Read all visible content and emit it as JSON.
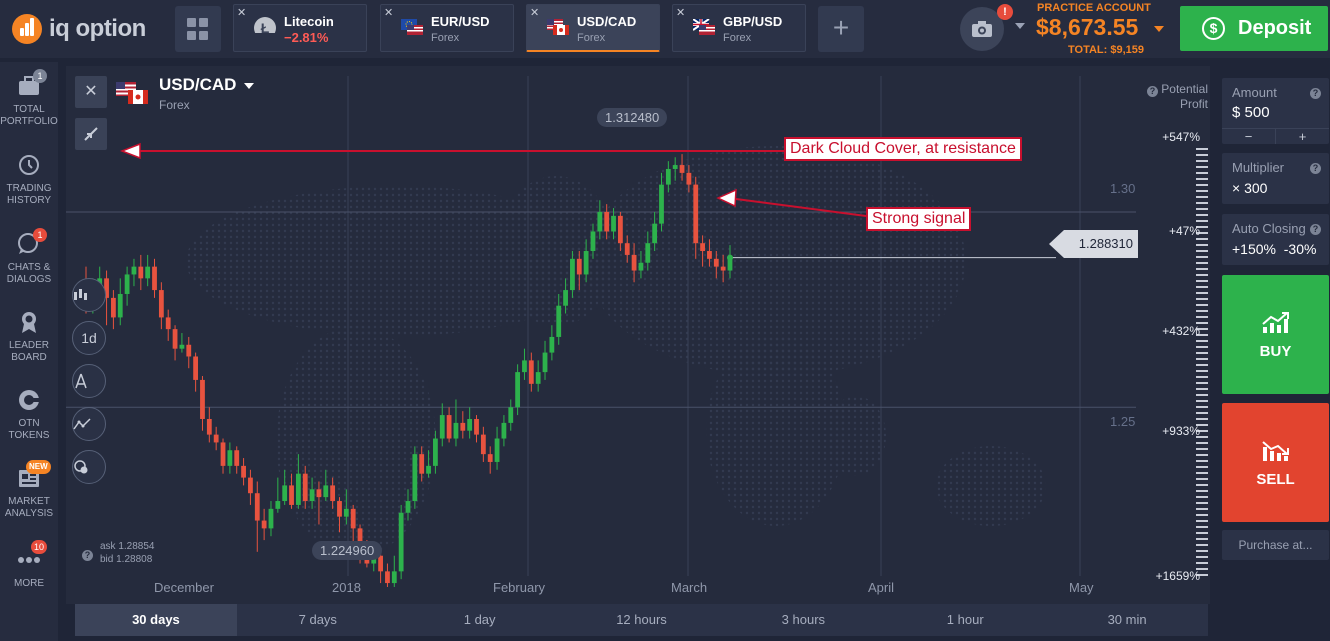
{
  "brand": {
    "name": "iq option"
  },
  "asset_tabs": [
    {
      "name": "Litecoin",
      "sub": "−2.81%",
      "sub_negative": true,
      "icon": "litecoin-icon"
    },
    {
      "name": "EUR/USD",
      "sub": "Forex",
      "icon": "flag-eu-us"
    },
    {
      "name": "USD/CAD",
      "sub": "Forex",
      "icon": "flag-us-ca",
      "active": true
    },
    {
      "name": "GBP/USD",
      "sub": "Forex",
      "icon": "flag-gb-us"
    }
  ],
  "account": {
    "label": "PRACTICE ACCOUNT",
    "balance": "$8,673.55",
    "total": "TOTAL: $9,159",
    "alert": "!"
  },
  "deposit": {
    "label": "Deposit"
  },
  "sidebar": {
    "items": [
      {
        "label_1": "TOTAL",
        "label_2": "PORTFOLIO",
        "badge": "1",
        "icon": "briefcase-icon"
      },
      {
        "label_1": "TRADING",
        "label_2": "HISTORY",
        "icon": "history-icon"
      },
      {
        "label_1": "CHATS &",
        "label_2": "DIALOGS",
        "badge": "1",
        "icon": "chat-icon"
      },
      {
        "label_1": "LEADER",
        "label_2": "BOARD",
        "icon": "award-icon"
      },
      {
        "label_1": "OTN",
        "label_2": "TOKENS",
        "icon": "otn-icon"
      },
      {
        "label_1": "MARKET",
        "label_2": "ANALYSIS",
        "badge": "NEW",
        "icon": "news-icon"
      },
      {
        "label_1": "MORE",
        "label_2": "",
        "badge": "10",
        "icon": "more-icon"
      }
    ]
  },
  "chart": {
    "pair": "USD/CAD",
    "category": "Forex",
    "potential_label_1": "Potential",
    "potential_label_2": "Profit",
    "current_price": "1.288310",
    "high_price": "1.312480",
    "low_price": "1.224960",
    "ask": "ask 1.28854",
    "bid": "bid 1.28808",
    "callout_resistance": "Dark Cloud Cover, at resistance",
    "callout_signal": "Strong signal",
    "timeframe_button": "1d",
    "y_ticks": [
      "1.30",
      "1.25"
    ],
    "x_ticks": [
      "December",
      "2018",
      "February",
      "March",
      "April",
      "May"
    ],
    "profit_ticks": [
      "+547%",
      "+47%",
      "+432%",
      "+933%",
      "+1659%"
    ],
    "accent_up": "#2db24c",
    "accent_down": "#e8533f"
  },
  "chart_data": {
    "type": "candlestick",
    "title": "USD/CAD",
    "ylabel": "",
    "ylim": [
      1.215,
      1.322
    ],
    "x_ticks": [
      "December",
      "2018",
      "February",
      "March",
      "April",
      "May"
    ],
    "candles": [
      [
        1.281,
        1.277,
        1.286,
        1.274
      ],
      [
        1.277,
        1.279,
        1.283,
        1.274
      ],
      [
        1.279,
        1.283,
        1.286,
        1.276
      ],
      [
        1.283,
        1.278,
        1.285,
        1.271
      ],
      [
        1.278,
        1.273,
        1.28,
        1.27
      ],
      [
        1.273,
        1.279,
        1.283,
        1.271
      ],
      [
        1.279,
        1.284,
        1.286,
        1.276
      ],
      [
        1.284,
        1.286,
        1.288,
        1.281
      ],
      [
        1.286,
        1.283,
        1.289,
        1.28
      ],
      [
        1.283,
        1.286,
        1.289,
        1.281
      ],
      [
        1.286,
        1.28,
        1.288,
        1.278
      ],
      [
        1.28,
        1.273,
        1.282,
        1.27
      ],
      [
        1.273,
        1.27,
        1.275,
        1.267
      ],
      [
        1.27,
        1.265,
        1.271,
        1.262
      ],
      [
        1.265,
        1.266,
        1.269,
        1.264
      ],
      [
        1.266,
        1.263,
        1.268,
        1.26
      ],
      [
        1.263,
        1.257,
        1.264,
        1.254
      ],
      [
        1.257,
        1.247,
        1.258,
        1.244
      ],
      [
        1.247,
        1.243,
        1.25,
        1.241
      ],
      [
        1.243,
        1.241,
        1.245,
        1.239
      ],
      [
        1.241,
        1.235,
        1.242,
        1.233
      ],
      [
        1.235,
        1.239,
        1.241,
        1.233
      ],
      [
        1.239,
        1.235,
        1.24,
        1.233
      ],
      [
        1.235,
        1.232,
        1.237,
        1.23
      ],
      [
        1.232,
        1.228,
        1.234,
        1.225
      ],
      [
        1.228,
        1.221,
        1.231,
        1.213
      ],
      [
        1.221,
        1.219,
        1.224,
        1.216
      ],
      [
        1.219,
        1.224,
        1.226,
        1.217
      ],
      [
        1.224,
        1.226,
        1.232,
        1.223
      ],
      [
        1.226,
        1.23,
        1.234,
        1.225
      ],
      [
        1.23,
        1.225,
        1.233,
        1.224
      ],
      [
        1.225,
        1.233,
        1.238,
        1.224
      ],
      [
        1.233,
        1.226,
        1.235,
        1.224
      ],
      [
        1.226,
        1.229,
        1.232,
        1.224
      ],
      [
        1.229,
        1.227,
        1.231,
        1.22
      ],
      [
        1.227,
        1.23,
        1.234,
        1.226
      ],
      [
        1.23,
        1.226,
        1.232,
        1.224
      ],
      [
        1.226,
        1.222,
        1.227,
        1.218
      ],
      [
        1.222,
        1.224,
        1.229,
        1.22
      ],
      [
        1.224,
        1.219,
        1.225,
        1.215
      ],
      [
        1.219,
        1.214,
        1.22,
        1.21
      ],
      [
        1.214,
        1.21,
        1.216,
        1.209
      ],
      [
        1.21,
        1.212,
        1.215,
        1.208
      ],
      [
        1.212,
        1.208,
        1.214,
        1.205
      ],
      [
        1.208,
        1.205,
        1.21,
        1.204
      ],
      [
        1.205,
        1.208,
        1.212,
        1.204
      ],
      [
        1.208,
        1.223,
        1.225,
        1.206
      ],
      [
        1.223,
        1.226,
        1.229,
        1.221
      ],
      [
        1.226,
        1.238,
        1.24,
        1.224
      ],
      [
        1.238,
        1.233,
        1.24,
        1.231
      ],
      [
        1.233,
        1.235,
        1.239,
        1.232
      ],
      [
        1.235,
        1.242,
        1.244,
        1.233
      ],
      [
        1.242,
        1.248,
        1.251,
        1.24
      ],
      [
        1.248,
        1.242,
        1.25,
        1.241
      ],
      [
        1.242,
        1.246,
        1.252,
        1.24
      ],
      [
        1.246,
        1.244,
        1.249,
        1.242
      ],
      [
        1.244,
        1.247,
        1.25,
        1.242
      ],
      [
        1.247,
        1.243,
        1.248,
        1.241
      ],
      [
        1.243,
        1.238,
        1.245,
        1.236
      ],
      [
        1.238,
        1.236,
        1.24,
        1.233
      ],
      [
        1.236,
        1.242,
        1.245,
        1.234
      ],
      [
        1.242,
        1.246,
        1.248,
        1.24
      ],
      [
        1.246,
        1.25,
        1.252,
        1.244
      ],
      [
        1.25,
        1.259,
        1.261,
        1.248
      ],
      [
        1.259,
        1.262,
        1.265,
        1.257
      ],
      [
        1.262,
        1.256,
        1.264,
        1.254
      ],
      [
        1.256,
        1.259,
        1.262,
        1.254
      ],
      [
        1.259,
        1.264,
        1.267,
        1.257
      ],
      [
        1.264,
        1.268,
        1.271,
        1.262
      ],
      [
        1.268,
        1.276,
        1.279,
        1.266
      ],
      [
        1.276,
        1.28,
        1.283,
        1.274
      ],
      [
        1.28,
        1.288,
        1.29,
        1.278
      ],
      [
        1.288,
        1.284,
        1.29,
        1.28
      ],
      [
        1.284,
        1.29,
        1.293,
        1.282
      ],
      [
        1.29,
        1.295,
        1.297,
        1.288
      ],
      [
        1.295,
        1.3,
        1.303,
        1.293
      ],
      [
        1.3,
        1.295,
        1.302,
        1.293
      ],
      [
        1.295,
        1.299,
        1.301,
        1.293
      ],
      [
        1.299,
        1.292,
        1.3,
        1.29
      ],
      [
        1.292,
        1.289,
        1.294,
        1.287
      ],
      [
        1.289,
        1.285,
        1.292,
        1.282
      ],
      [
        1.285,
        1.287,
        1.29,
        1.283
      ],
      [
        1.287,
        1.292,
        1.295,
        1.285
      ],
      [
        1.292,
        1.297,
        1.3,
        1.29
      ],
      [
        1.297,
        1.307,
        1.31,
        1.295
      ],
      [
        1.307,
        1.311,
        1.313,
        1.305
      ],
      [
        1.311,
        1.312,
        1.314,
        1.308
      ],
      [
        1.312,
        1.31,
        1.3148,
        1.308
      ],
      [
        1.31,
        1.307,
        1.312,
        1.305
      ],
      [
        1.307,
        1.292,
        1.309,
        1.288
      ],
      [
        1.292,
        1.29,
        1.294,
        1.286
      ],
      [
        1.29,
        1.288,
        1.293,
        1.286
      ],
      [
        1.288,
        1.286,
        1.29,
        1.283
      ],
      [
        1.286,
        1.285,
        1.289,
        1.282
      ],
      [
        1.285,
        1.2883,
        1.2915,
        1.283
      ]
    ],
    "last_price": 1.28831,
    "high": 1.31248,
    "low": 1.22496,
    "resistance": 1.3107,
    "potential_profit": [
      "+547%",
      "+47%",
      "+432%",
      "+933%",
      "+1659%"
    ]
  },
  "trade": {
    "amount_label": "Amount",
    "amount_value": "$  500",
    "minus": "−",
    "plus": "+",
    "multiplier_label": "Multiplier",
    "multiplier_value": "× 300",
    "auto_label": "Auto Closing",
    "auto_value": "+150%  -30%",
    "buy": "BUY",
    "sell": "SELL",
    "purchase": "Purchase at..."
  },
  "timeframes": [
    "30 days",
    "7 days",
    "1 day",
    "12 hours",
    "3 hours",
    "1 hour",
    "30 min"
  ]
}
